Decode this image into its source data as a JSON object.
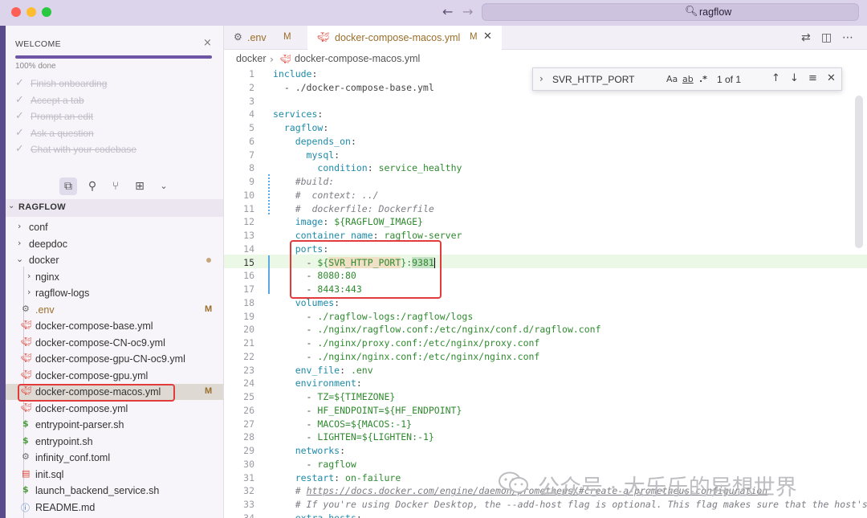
{
  "titlebar": {
    "search_icon": "🔍︎",
    "search_text": "ragflow",
    "nav_back": "←",
    "nav_forward": "→"
  },
  "welcome": {
    "title": "WELCOME",
    "close_icon": "×",
    "progress_label": "100% done",
    "progress_fraction": 1.0,
    "tasks": [
      {
        "label": "Finish onboarding",
        "checked": true
      },
      {
        "label": "Accept a tab",
        "checked": true
      },
      {
        "label": "Prompt an edit",
        "checked": true
      },
      {
        "label": "Ask a question",
        "checked": true
      },
      {
        "label": "Chat with your codebase",
        "checked": true
      }
    ]
  },
  "view_icons": [
    "files-icon",
    "search-icon",
    "source-control-icon",
    "extensions-icon",
    "chevron-down-icon"
  ],
  "explorer": {
    "section": "RAGFLOW",
    "items": [
      {
        "label": "conf",
        "type": "folder",
        "open": false,
        "depth": 0
      },
      {
        "label": "deepdoc",
        "type": "folder",
        "open": false,
        "depth": 0
      },
      {
        "label": "docker",
        "type": "folder",
        "open": true,
        "depth": 0,
        "dot": true
      },
      {
        "label": "nginx",
        "type": "folder",
        "open": false,
        "depth": 1
      },
      {
        "label": "ragflow-logs",
        "type": "folder",
        "open": false,
        "depth": 1
      },
      {
        "label": ".env",
        "type": "gear",
        "depth": 1,
        "badge": "M",
        "badge_color": "#9b6e2a"
      },
      {
        "label": "docker-compose-base.yml",
        "type": "docker",
        "depth": 1
      },
      {
        "label": "docker-compose-CN-oc9.yml",
        "type": "docker",
        "depth": 1
      },
      {
        "label": "docker-compose-gpu-CN-oc9.yml",
        "type": "docker",
        "depth": 1
      },
      {
        "label": "docker-compose-gpu.yml",
        "type": "docker",
        "depth": 1
      },
      {
        "label": "docker-compose-macos.yml",
        "type": "docker",
        "depth": 1,
        "badge": "M",
        "selected": true
      },
      {
        "label": "docker-compose.yml",
        "type": "docker",
        "depth": 1
      },
      {
        "label": "entrypoint-parser.sh",
        "type": "shell",
        "depth": 1
      },
      {
        "label": "entrypoint.sh",
        "type": "shell",
        "depth": 1
      },
      {
        "label": "infinity_conf.toml",
        "type": "gear",
        "depth": 1
      },
      {
        "label": "init.sql",
        "type": "db",
        "depth": 1
      },
      {
        "label": "launch_backend_service.sh",
        "type": "shell",
        "depth": 1
      },
      {
        "label": "README.md",
        "type": "info",
        "depth": 1
      }
    ]
  },
  "tabs": [
    {
      "label": ".env",
      "modified": "M",
      "active": false
    },
    {
      "label": "docker-compose-macos.yml",
      "modified": "M",
      "active": true
    }
  ],
  "tab_actions": [
    "compare-icon",
    "split-editor-icon",
    "more-icon"
  ],
  "breadcrumbs": [
    "docker",
    "docker-compose-macos.yml"
  ],
  "find": {
    "value": "SVR_HTTP_PORT",
    "match_case": "Aa",
    "whole_word": "ab",
    "regex": ".*",
    "count": "1 of 1"
  },
  "code_lines": [
    {
      "n": "1",
      "html": "<span class=\"k\">include</span>:"
    },
    {
      "n": "2",
      "html": "  - ./docker-compose-base.yml"
    },
    {
      "n": "3",
      "html": ""
    },
    {
      "n": "4",
      "html": "<span class=\"k\">services</span>:"
    },
    {
      "n": "5",
      "html": "  <span class=\"k\">ragflow</span>:"
    },
    {
      "n": "6",
      "html": "    <span class=\"k\">depends_on</span>:"
    },
    {
      "n": "7",
      "html": "      <span class=\"k\">mysql</span>:"
    },
    {
      "n": "8",
      "html": "        <span class=\"k\">condition</span>: <span class=\"s\">service_healthy</span>"
    },
    {
      "n": "9",
      "html": "    <span class=\"c\">#build:</span>"
    },
    {
      "n": "10",
      "html": "    <span class=\"c\">#  context: ../</span>"
    },
    {
      "n": "11",
      "html": "    <span class=\"c\">#  dockerfile: Dockerfile</span>"
    },
    {
      "n": "12",
      "html": "    <span class=\"k\">image</span>: <span class=\"s\">${RAGFLOW_IMAGE}</span>"
    },
    {
      "n": "13",
      "html": "    <span class=\"k\">container_name</span>: <span class=\"s\">ragflow-server</span>"
    },
    {
      "n": "14",
      "html": "    <span class=\"k\">ports</span>:"
    },
    {
      "n": "15",
      "html": "      - <span class=\"s\">${<span class=\"find-hl\">SVR_HTTP_PORT</span>}:<span class=\"sel-hl\">9381</span></span><span class=\"caret\"></span>"
    },
    {
      "n": "16",
      "html": "      - <span class=\"s\">8080:80</span>"
    },
    {
      "n": "17",
      "html": "      - <span class=\"s\">8443:443</span>"
    },
    {
      "n": "18",
      "html": "    <span class=\"k\">volumes</span>:"
    },
    {
      "n": "19",
      "html": "      - <span class=\"s\">./ragflow-logs:/ragflow/logs</span>"
    },
    {
      "n": "20",
      "html": "      - <span class=\"s\">./nginx/ragflow.conf:/etc/nginx/conf.d/ragflow.conf</span>"
    },
    {
      "n": "21",
      "html": "      - <span class=\"s\">./nginx/proxy.conf:/etc/nginx/proxy.conf</span>"
    },
    {
      "n": "22",
      "html": "      - <span class=\"s\">./nginx/nginx.conf:/etc/nginx/nginx.conf</span>"
    },
    {
      "n": "23",
      "html": "    <span class=\"k\">env_file</span>: <span class=\"s\">.env</span>"
    },
    {
      "n": "24",
      "html": "    <span class=\"k\">environment</span>:"
    },
    {
      "n": "25",
      "html": "      - <span class=\"s\">TZ=${TIMEZONE}</span>"
    },
    {
      "n": "26",
      "html": "      - <span class=\"s\">HF_ENDPOINT=${HF_ENDPOINT}</span>"
    },
    {
      "n": "27",
      "html": "      - <span class=\"s\">MACOS=${MACOS:-1}</span>"
    },
    {
      "n": "28",
      "html": "      - <span class=\"s\">LIGHTEN=${LIGHTEN:-1}</span>"
    },
    {
      "n": "29",
      "html": "    <span class=\"k\">networks</span>:"
    },
    {
      "n": "30",
      "html": "      - <span class=\"s\">ragflow</span>"
    },
    {
      "n": "31",
      "html": "    <span class=\"k\">restart</span>: <span class=\"s\">on-failure</span>"
    },
    {
      "n": "32",
      "html": "    <span class=\"c\"># <span class=\"u\">https://docs.docker.com/engine/daemon/prometheus/#create-a-prometheus-configuration</span></span>"
    },
    {
      "n": "33",
      "html": "    <span class=\"c\"># If you're using Docker Desktop, the --add-host flag is optional. This flag makes sure that the host's in</span>"
    },
    {
      "n": "34",
      "html": "    <span class=\"k\">extra_hosts</span>:"
    }
  ],
  "watermark": {
    "text": "公众号 · 大乐乐的异想世界"
  },
  "colors": {
    "accent": "#6e55a6",
    "highlight_box": "#e23b3b",
    "yaml_key": "#1d8aa8",
    "yaml_string": "#2f8a2f",
    "modified_badge": "#9b6e2a"
  }
}
